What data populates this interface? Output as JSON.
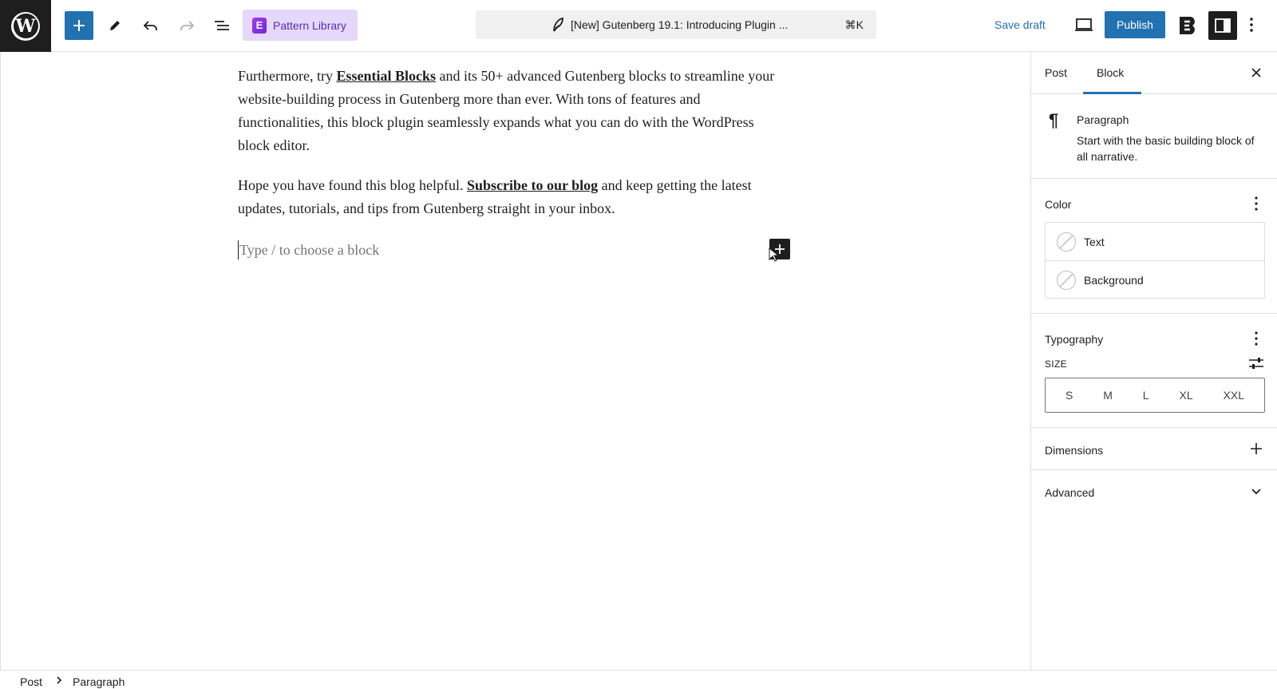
{
  "topbar": {
    "pattern_library_label": "Pattern Library",
    "pattern_library_logo": "E",
    "document_title": "[New] Gutenberg 19.1: Introducing Plugin ...",
    "shortcut": "⌘K",
    "save_draft_label": "Save draft",
    "publish_label": "Publish",
    "accent_color": "#2271b1"
  },
  "editor": {
    "paragraph1": {
      "before": "Furthermore, try ",
      "link": "Essential Blocks",
      "after": " and its 50+ advanced Gutenberg blocks to streamline your website-building process in Gutenberg more than ever. With tons of features and functionalities, this block plugin seamlessly expands what you can do with the WordPress block editor."
    },
    "paragraph2": {
      "before": "Hope you have found this blog helpful. ",
      "link": "Subscribe to our blog",
      "after": " and keep getting the latest updates, tutorials, and tips from Gutenberg straight in your inbox."
    },
    "placeholder": "Type / to choose a block"
  },
  "sidebar": {
    "tabs": [
      {
        "label": "Post",
        "active": false
      },
      {
        "label": "Block",
        "active": true
      }
    ],
    "block": {
      "name": "Paragraph",
      "description": "Start with the basic building block of all narrative."
    },
    "color": {
      "title": "Color",
      "items": [
        {
          "label": "Text"
        },
        {
          "label": "Background"
        }
      ]
    },
    "typography": {
      "title": "Typography",
      "size_label": "SIZE",
      "sizes": [
        "S",
        "M",
        "L",
        "XL",
        "XXL"
      ]
    },
    "dimensions": {
      "title": "Dimensions"
    },
    "advanced": {
      "title": "Advanced"
    }
  },
  "footer": {
    "breadcrumb": [
      "Post",
      "Paragraph"
    ]
  }
}
